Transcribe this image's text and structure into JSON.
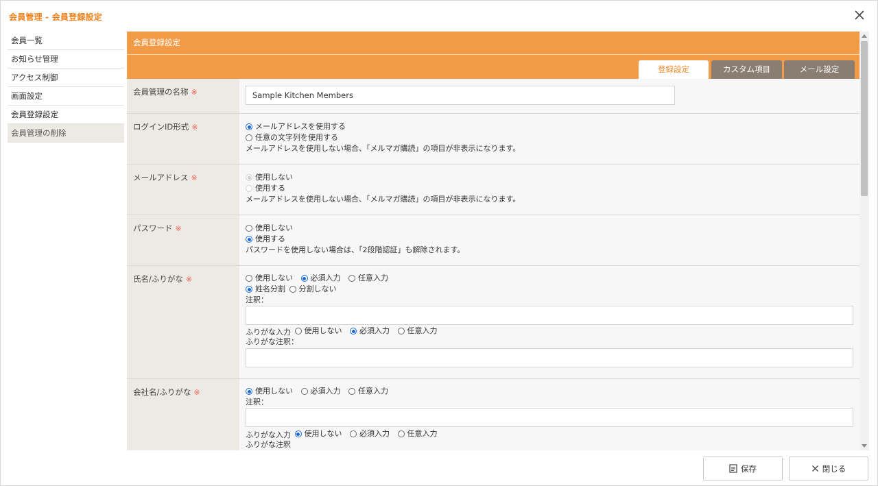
{
  "dialog": {
    "title": "会員管理 - 会員登録設定"
  },
  "sidebar": {
    "items": [
      {
        "label": "会員一覧"
      },
      {
        "label": "お知らせ管理"
      },
      {
        "label": "アクセス制御"
      },
      {
        "label": "画面設定"
      },
      {
        "label": "会員登録設定"
      },
      {
        "label": "会員管理の削除"
      }
    ]
  },
  "content": {
    "header": "会員登録設定",
    "tabs": [
      {
        "label": "登録設定"
      },
      {
        "label": "カスタム項目"
      },
      {
        "label": "メール設定"
      }
    ]
  },
  "required_mark": "※",
  "form": {
    "name": {
      "label": "会員管理の名称",
      "value": "Sample Kitchen Members"
    },
    "login": {
      "label": "ログインID形式",
      "opt1": "メールアドレスを使用する",
      "opt2": "任意の文字列を使用する",
      "note": "メールアドレスを使用しない場合、「メルマガ購読」の項目が非表示になります。"
    },
    "email": {
      "label": "メールアドレス",
      "opt1": "使用しない",
      "opt2": "使用する",
      "note": "メールアドレスを使用しない場合、「メルマガ購読」の項目が非表示になります。"
    },
    "password": {
      "label": "パスワード",
      "opt1": "使用しない",
      "opt2": "使用する",
      "note": "パスワードを使用しない場合は、「2段階認証」も解除されます。"
    },
    "fullname": {
      "label": "氏名/ふりがな",
      "opt1": "使用しない",
      "opt2": "必須入力",
      "opt3": "任意入力",
      "split1": "姓名分割",
      "split2": "分割しない",
      "annotation": "注釈：",
      "furigana_label": "ふりがな入力",
      "f_opt1": "使用しない",
      "f_opt2": "必須入力",
      "f_opt3": "任意入力",
      "furigana_annotation": "ふりがな注釈："
    },
    "company": {
      "label": "会社名/ふりがな",
      "opt1": "使用しない",
      "opt2": "必須入力",
      "opt3": "任意入力",
      "annotation": "注釈：",
      "furigana_label": "ふりがな入力",
      "f_opt1": "使用しない",
      "f_opt2": "必須入力",
      "f_opt3": "任意入力",
      "furigana_annotation": "ふりがな注釈"
    }
  },
  "footer": {
    "save": "保存",
    "close": "閉じる"
  }
}
